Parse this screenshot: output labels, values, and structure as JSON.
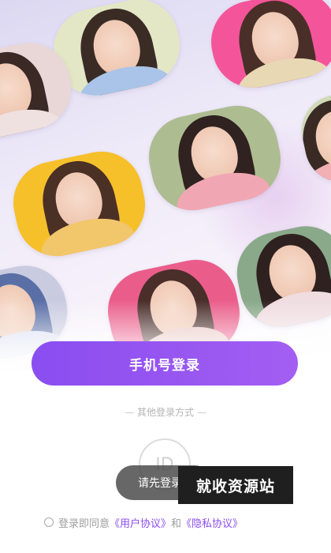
{
  "gallery": {
    "photos": [
      {
        "name": "photo-girl-blue-dress",
        "bg": "#e3e7c6",
        "hair": "#3b2b25",
        "body": "#a9c4e8"
      },
      {
        "name": "photo-girl-pink-flowers",
        "bg": "#f4559a",
        "hair": "#4a2f28",
        "body": "#e8d9b4"
      },
      {
        "name": "photo-girl-left-edge",
        "bg": "#e9d7d8",
        "hair": "#3a2924",
        "body": "#f0e1e1"
      },
      {
        "name": "photo-girl-hands-face",
        "bg": "#aebc92",
        "hair": "#2f2220",
        "body": "#f1a7b3"
      },
      {
        "name": "photo-girl-yellow",
        "bg": "#f6c02a",
        "hair": "#4b3026",
        "body": "#f2c66b"
      },
      {
        "name": "photo-girl-right-edge",
        "bg": "#cfd9b8",
        "hair": "#3a2a24",
        "body": "#f3b0b4"
      },
      {
        "name": "photo-girl-green-bg",
        "bg": "#8aa98a",
        "hair": "#2e211f",
        "body": "#efdde0"
      },
      {
        "name": "photo-girl-blue-bottom-left",
        "bg": "#c9cbe0",
        "hair": "#5a6fa6",
        "body": "#d7def0"
      },
      {
        "name": "photo-girl-pink-center",
        "bg": "#ea5d8a",
        "hair": "#4a2e2a",
        "body": "#e8c6c1"
      }
    ]
  },
  "login": {
    "phone_login_label": "手机号登录",
    "other_methods_label": "其他登录方式",
    "id_icon_text": "ID",
    "toast_text": "请先登录",
    "watermark_text": "就收资源站"
  },
  "agreement": {
    "prefix": "登录即同意",
    "user_agreement": "《用户协议》",
    "and": "和",
    "privacy_agreement": "《隐私协议》"
  }
}
